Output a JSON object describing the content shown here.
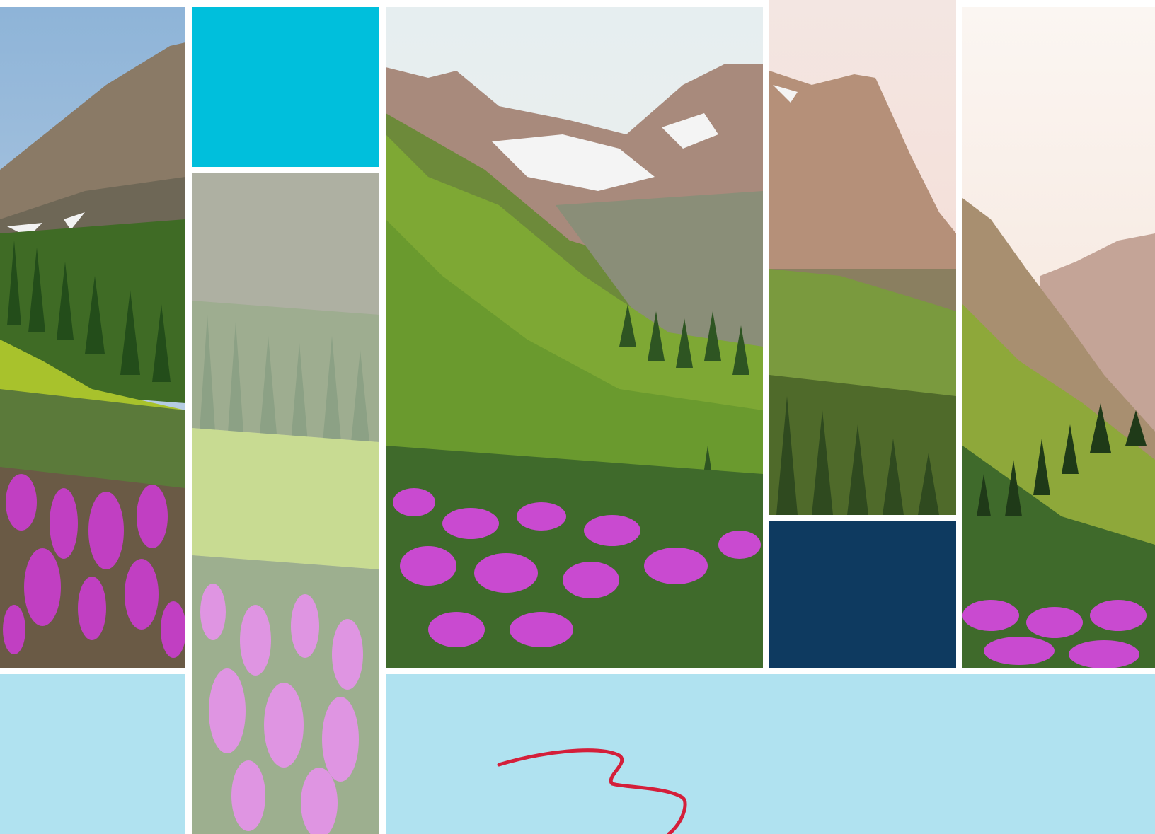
{
  "colors": {
    "cyan": "#00bfdc",
    "navy": "#0e3a60",
    "light_blue": "#b0e2f0",
    "logo_red": "#d41f3a",
    "divider": "#ffffff"
  },
  "panels": [
    {
      "name": "photo-panel-1",
      "subject": "mountain-with-wildflowers"
    },
    {
      "name": "photo-panel-2",
      "subject": "faded-forest-wildflowers"
    },
    {
      "name": "photo-panel-3",
      "subject": "snowy-peaks-valley"
    },
    {
      "name": "photo-panel-4",
      "subject": "rocky-peak"
    },
    {
      "name": "photo-panel-5",
      "subject": "sunlit-valley"
    }
  ],
  "icons": {
    "logo": "swoosh-logo-icon"
  }
}
